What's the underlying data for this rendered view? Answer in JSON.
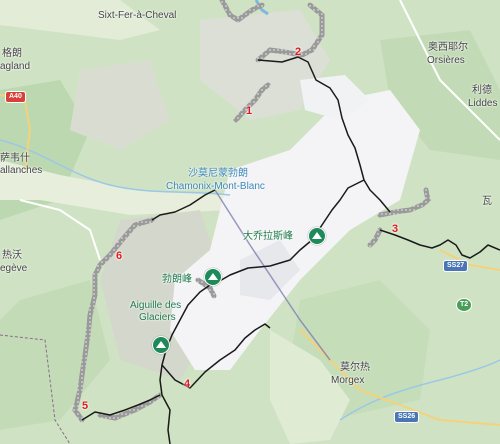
{
  "map": {
    "towns": {
      "sixt": "Sixt-Fer-à-Cheval",
      "orsieres_cn": "奥西耶尔",
      "orsieres": "Orsières",
      "liddes_cn": "利德",
      "liddes": "Liddes",
      "left_top_cn": "格朗",
      "left_top": "agland",
      "left_mid_cn": "萨韦什",
      "left_mid": "allanches",
      "left_bot_cn": "热沃",
      "left_bot": "egève",
      "right_edge": "瓦",
      "chamonix_cn": "沙莫尼蒙勃朗",
      "chamonix": "Chamonix-Mont-Blanc",
      "morgex_cn": "莫尔热",
      "morgex": "Morgex"
    },
    "peaks": {
      "grandes_jorasses": "大乔拉斯峰",
      "mont_blanc": "勃朗峰",
      "aiguille_line1": "Aiguille des",
      "aiguille_line2": "Glaciers"
    },
    "road_shields": {
      "a40": "A40",
      "ss27": "SS27",
      "t2": "T2",
      "ss26": "SS26"
    },
    "segment_numbers": [
      "1",
      "2",
      "3",
      "4",
      "5",
      "6"
    ],
    "colors": {
      "route_black": "#1a1a1a",
      "route_grey": "#8a8a8a",
      "segment_number": "#e01b1b",
      "peak_marker": "#1e8a5a",
      "glacier": "#f4f4f6",
      "border_line": "#7f7fb0"
    }
  }
}
